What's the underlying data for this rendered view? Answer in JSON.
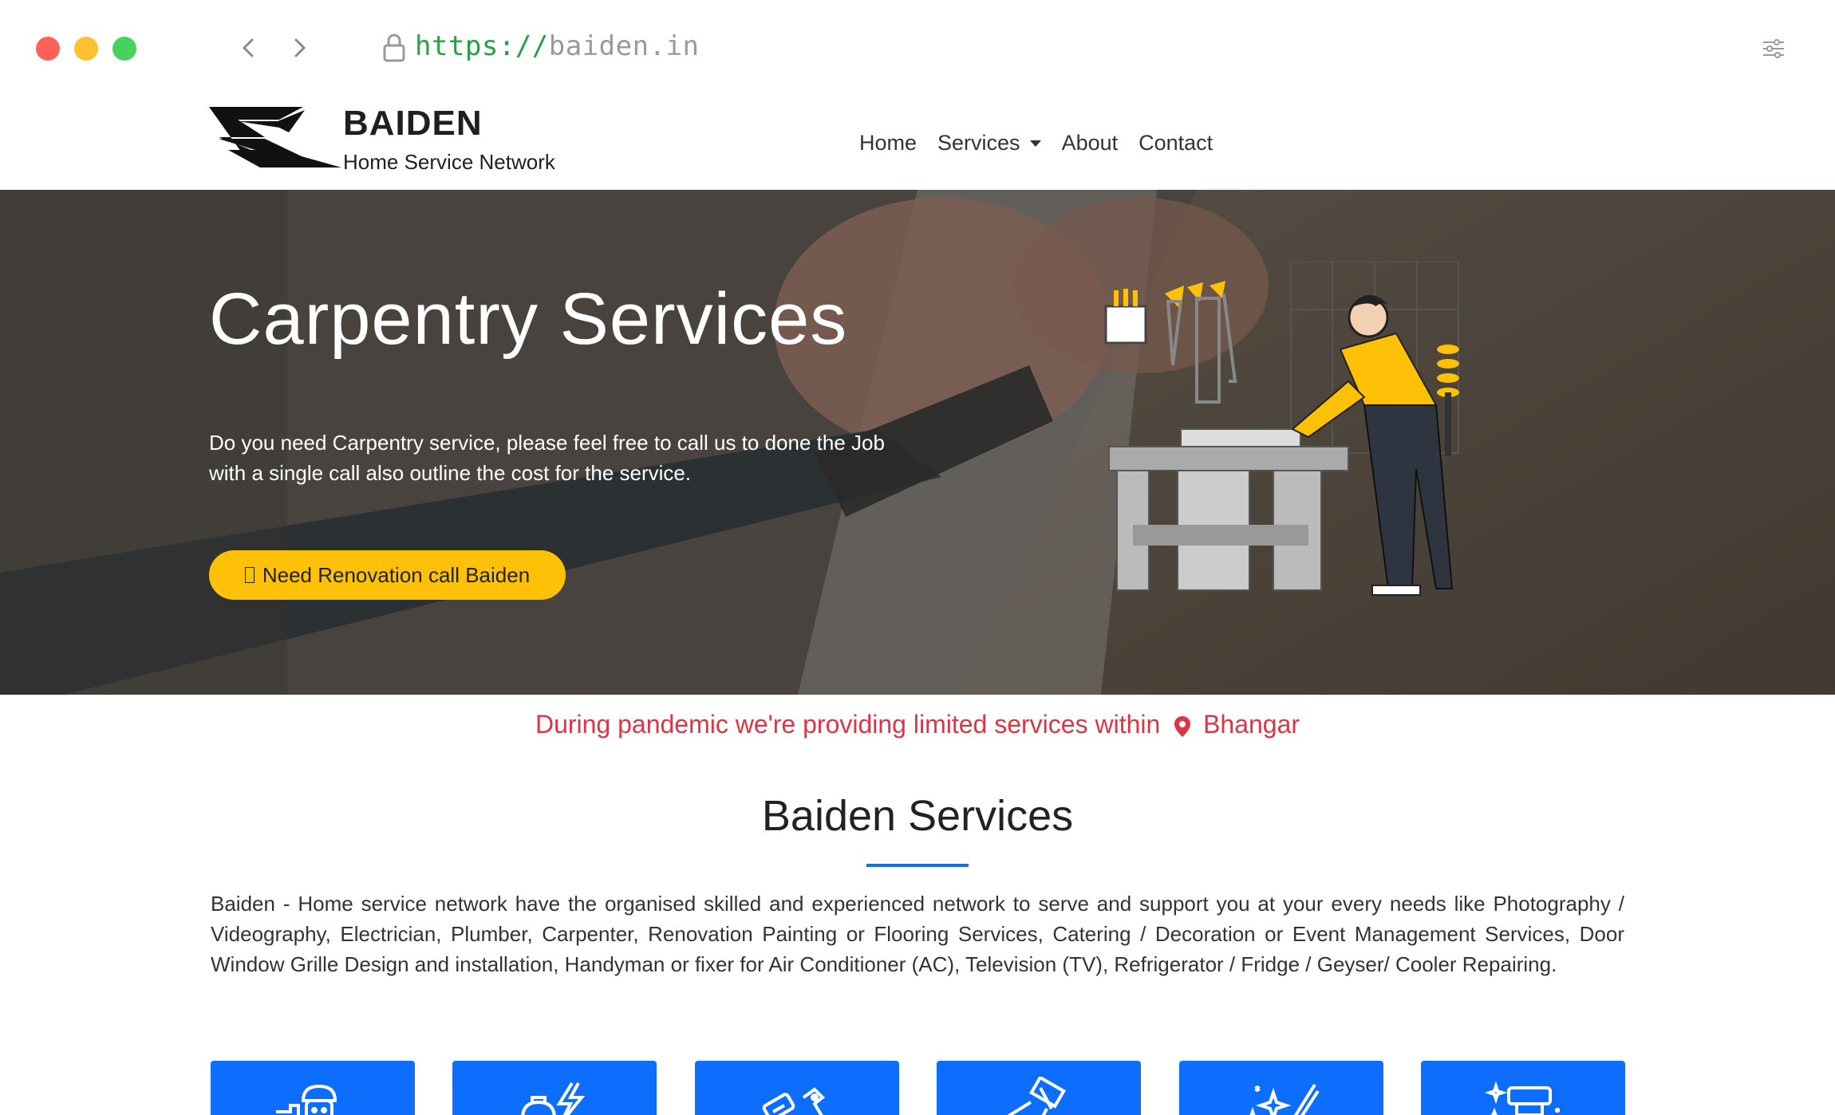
{
  "browser": {
    "url_protocol": "https://",
    "url_host": "baiden.in"
  },
  "brand": {
    "name": "BAIDEN",
    "tagline": "Home Service Network"
  },
  "nav": {
    "items": [
      "Home",
      "Services",
      "About",
      "Contact"
    ]
  },
  "hero": {
    "title": "Carpentry Services",
    "description": "Do you need Carpentry service, please feel free to call us to done the Job with a single call also outline the cost for the service.",
    "cta_label": "Need Renovation call Baiden"
  },
  "notice": {
    "text": "During pandemic we're providing limited services within",
    "location": "Bhangar"
  },
  "services": {
    "title": "Baiden Services",
    "description": "Baiden - Home service network have the organised skilled and experienced network to serve and support you at your every needs like Photography / Videography, Electrician, Plumber, Carpenter, Renovation Painting or Flooring Services, Catering / Decoration or Event Management Services, Door Window Grille Design and installation, Handyman or fixer for Air Conditioner (AC), Television (TV), Refrigerator / Fridge / Geyser/ Cooler Repairing.",
    "cards": [
      {
        "icon": "plumber-icon"
      },
      {
        "icon": "electrician-icon"
      },
      {
        "icon": "tools-icon"
      },
      {
        "icon": "painting-icon"
      },
      {
        "icon": "decoration-icon"
      },
      {
        "icon": "repair-icon"
      }
    ]
  },
  "colors": {
    "accent_blue": "#0d6efd",
    "cta_yellow": "#ffc107",
    "notice_red": "#dc3545"
  }
}
